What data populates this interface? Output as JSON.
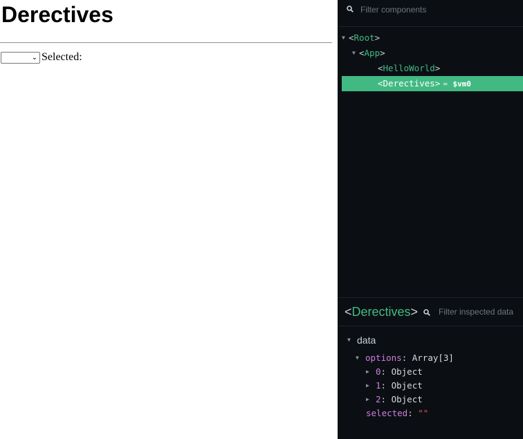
{
  "page": {
    "heading": "Derectives",
    "select": {
      "value": ""
    },
    "selected_label": "Selected:"
  },
  "devtools": {
    "filter_components_placeholder": "Filter components",
    "tree": [
      {
        "bracket_open": "<",
        "name": "Root",
        "bracket_close": ">"
      },
      {
        "bracket_open": "<",
        "name": "App",
        "bracket_close": ">"
      },
      {
        "bracket_open": "<",
        "name": "HelloWorld",
        "bracket_close": ">"
      },
      {
        "bracket_open": "<",
        "name": "Derectives",
        "bracket_close": ">",
        "eq": "=",
        "vm": "$vm0"
      }
    ],
    "inspector": {
      "bracket_open": "<",
      "component": "Derectives",
      "bracket_close": ">",
      "filter_placeholder": "Filter inspected data"
    },
    "data": {
      "section": "data",
      "options_key": "options",
      "options_value": "Array[3]",
      "items": [
        {
          "key": "0",
          "value": "Object"
        },
        {
          "key": "1",
          "value": "Object"
        },
        {
          "key": "2",
          "value": "Object"
        }
      ],
      "selected_key": "selected",
      "selected_value": "\"\""
    },
    "colors": {
      "background": "#0b0f14",
      "accent": "#42b983",
      "key": "#d17dde",
      "string": "#e5534b"
    }
  }
}
